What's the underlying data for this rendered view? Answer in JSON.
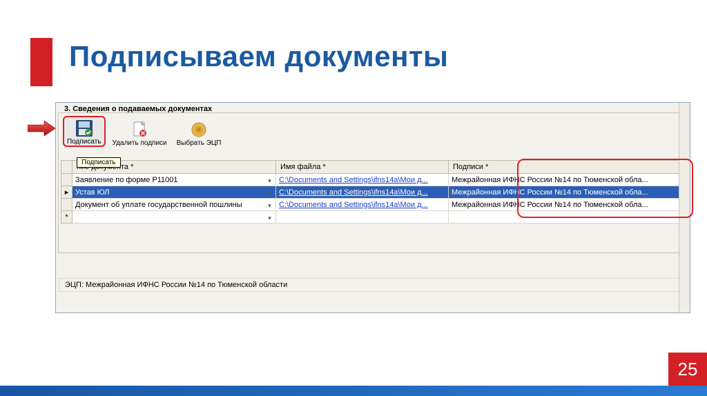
{
  "slide": {
    "title": "Подписываем документы",
    "page_number": "25"
  },
  "section": {
    "header": "3. Сведения о подаваемых документах",
    "status": "ЭЦП: Межрайонная ИФНС России №14 по Тюменской области"
  },
  "toolbar": {
    "sign": "Подписать",
    "remove": "Удалить подписи",
    "select_ecp": "Выбрать ЭЦП",
    "tooltip": "Подписать"
  },
  "grid": {
    "headers": {
      "doc_name": "ние документа *",
      "file_name": "Имя файла *",
      "signatures": "Подписи *"
    },
    "rows": [
      {
        "doc": "Заявление по форме Р11001",
        "file": "C:\\Documents and Settings\\ifns14a\\Мои д...",
        "sign": "Межрайонная ИФНС России №14 по Тюменской обла...",
        "marker": ""
      },
      {
        "doc": "Устав ЮЛ",
        "file": "C:\\Documents and Settings\\ifns14a\\Мои д...",
        "sign": "Межрайонная ИФНС России №14 по Тюменской обла...",
        "marker": "▸",
        "selected": true
      },
      {
        "doc": "Документ об уплате государственной пошлины",
        "file": "C:\\Documents and Settings\\ifns14a\\Мои д...",
        "sign": "Межрайонная ИФНС России №14 по Тюменской обла...",
        "marker": ""
      },
      {
        "doc": "",
        "file": "",
        "sign": "",
        "marker": "*"
      }
    ]
  }
}
